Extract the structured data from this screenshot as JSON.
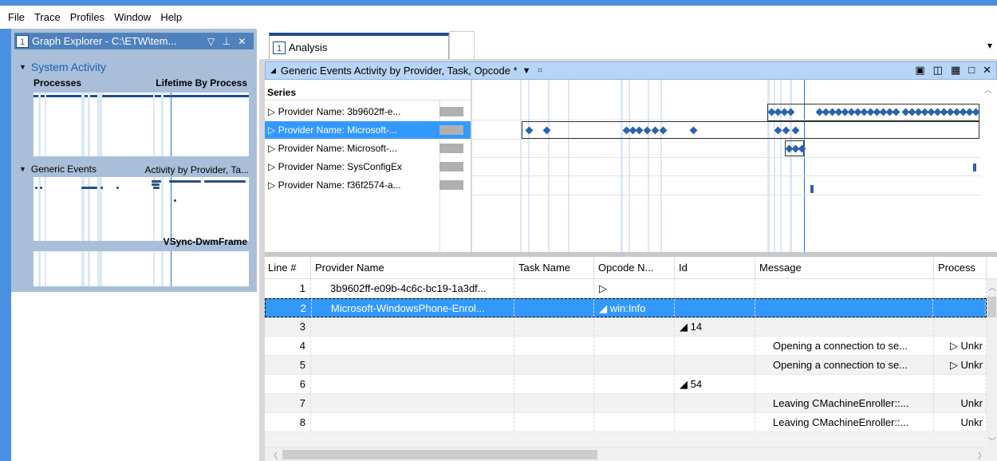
{
  "menu": [
    "File",
    "Trace",
    "Profiles",
    "Window",
    "Help"
  ],
  "graph_explorer": {
    "tab_number": "1",
    "title": "Graph Explorer - C:\\ETW\\tem...",
    "sections": {
      "system_activity": {
        "title": "System Activity",
        "left_label": "Processes",
        "right_label": "Lifetime By Process"
      },
      "generic_events": {
        "title": "Generic Events",
        "right_label": "Activity by Provider, Ta..."
      },
      "vsync": {
        "right_label": "VSync-DwmFrame"
      }
    }
  },
  "analysis": {
    "tab_number": "1",
    "tab_label": "Analysis",
    "view_title": "Generic Events  Activity by Provider, Task, Opcode *",
    "series_header": "Series",
    "series": [
      "Provider Name: 3b9602ff-e...",
      "Provider Name: Microsoft-...",
      "Provider Name: Microsoft-...",
      "Provider Name: SysConfigEx",
      "Provider Name: f36f2574-a..."
    ],
    "columns": [
      "Line #",
      "Provider Name",
      "Task Name",
      "Opcode N...",
      "Id",
      "Message",
      "Process"
    ],
    "rows": [
      {
        "line": "1",
        "provider": "3b9602ff-e09b-4c6c-bc19-1a3df...",
        "task": "",
        "opcode": "▷",
        "id": "",
        "message": "",
        "process": ""
      },
      {
        "line": "2",
        "provider": "Microsoft-WindowsPhone-Enrol...",
        "task": "",
        "opcode": "◢ win:Info",
        "id": "",
        "message": "",
        "process": ""
      },
      {
        "line": "3",
        "provider": "",
        "task": "",
        "opcode": "",
        "id": "◢ 14",
        "message": "",
        "process": ""
      },
      {
        "line": "4",
        "provider": "",
        "task": "",
        "opcode": "",
        "id": "",
        "message": "Opening a connection to se...",
        "process": "▷ Unkr"
      },
      {
        "line": "5",
        "provider": "",
        "task": "",
        "opcode": "",
        "id": "",
        "message": "Opening a connection to se...",
        "process": "▷ Unkr"
      },
      {
        "line": "6",
        "provider": "",
        "task": "",
        "opcode": "",
        "id": "◢ 54",
        "message": "",
        "process": ""
      },
      {
        "line": "7",
        "provider": "",
        "task": "",
        "opcode": "",
        "id": "",
        "message": "Leaving  CMachineEnroller::...",
        "process": "Unkr"
      },
      {
        "line": "8",
        "provider": "",
        "task": "",
        "opcode": "",
        "id": "",
        "message": "Leaving  CMachineEnroller::...",
        "process": "Unkr"
      }
    ]
  }
}
